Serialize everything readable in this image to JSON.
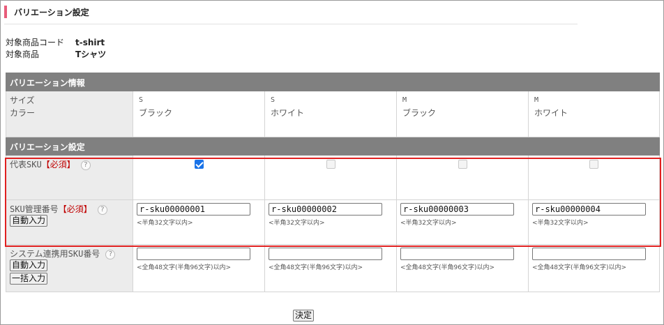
{
  "page": {
    "title": "バリエーション設定"
  },
  "meta": {
    "code_label": "対象商品コード",
    "code_value": "t-shirt",
    "product_label": "対象商品",
    "product_value": "Tシャツ"
  },
  "info": {
    "section_title": "バリエーション情報",
    "label_size": "サイズ",
    "label_color": "カラー",
    "columns": [
      {
        "size": "S",
        "color": "ブラック"
      },
      {
        "size": "S",
        "color": "ホワイト"
      },
      {
        "size": "M",
        "color": "ブラック"
      },
      {
        "size": "M",
        "color": "ホワイト"
      }
    ]
  },
  "settings": {
    "section_title": "バリエーション設定",
    "rep_sku": {
      "label": "代表SKU",
      "required": "【必須】",
      "help": "?",
      "checked": [
        true,
        false,
        false,
        false
      ]
    },
    "sku_mgmt": {
      "label": "SKU管理番号",
      "required": "【必須】",
      "help": "?",
      "auto_button": "自動入力",
      "values": [
        "r-sku00000001",
        "r-sku00000002",
        "r-sku00000003",
        "r-sku00000004"
      ],
      "hint": "<半角32文字以内>"
    },
    "system_sku": {
      "label": "システム連携用SKU番号",
      "help": "?",
      "auto_button": "自動入力",
      "bulk_button": "一括入力",
      "values": [
        "",
        "",
        "",
        ""
      ],
      "hint": "<全角48文字(半角96文字)以内>"
    }
  },
  "actions": {
    "submit": "決定"
  },
  "colors": {
    "accent": "#e85c7a",
    "section_header": "#808080",
    "highlight": "#e02020",
    "required": "#c00000",
    "checkbox_on": "#1a73e8"
  }
}
